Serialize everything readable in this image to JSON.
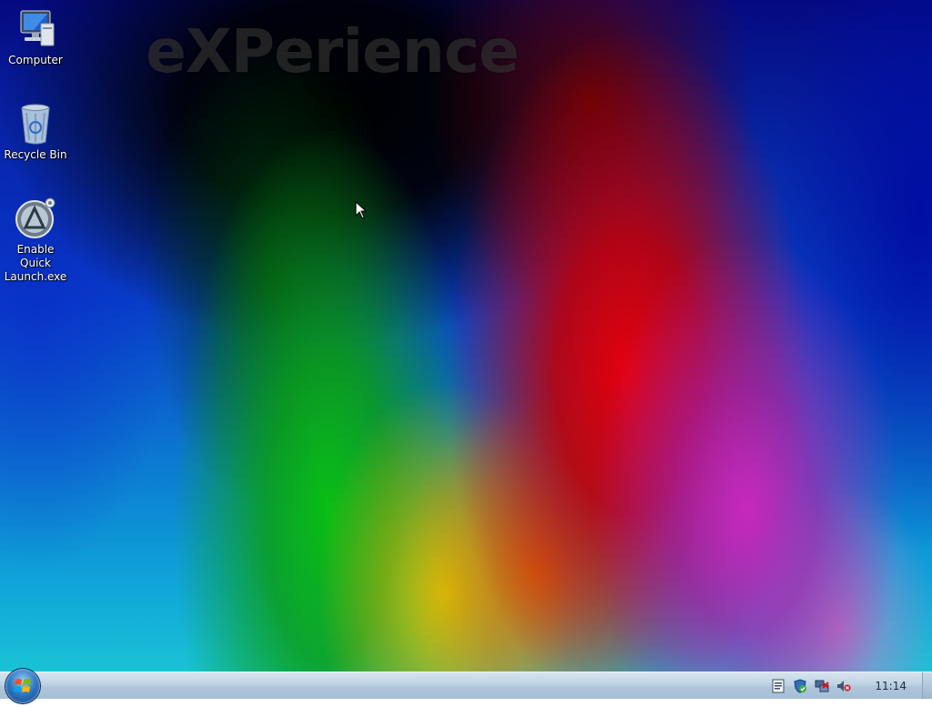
{
  "wallpaper": {
    "watermark_text": "eXPerience"
  },
  "desktop_icons": [
    {
      "label": "Computer",
      "icon": "computer-icon"
    },
    {
      "label": "Recycle Bin",
      "icon": "recycle-bin-icon"
    },
    {
      "label": "Enable Quick Launch.exe",
      "icon": "quick-launch-app-icon"
    }
  ],
  "taskbar": {
    "start_icon": "windows-logo-icon",
    "tray_icons": [
      "notes-icon",
      "security-shield-icon",
      "network-icon",
      "volume-muted-icon"
    ],
    "clock": "11:14"
  },
  "colors": {
    "taskbar_top": "#d7e4ef",
    "taskbar_bottom": "#a7bfd5",
    "icon_label": "#ffffff"
  }
}
